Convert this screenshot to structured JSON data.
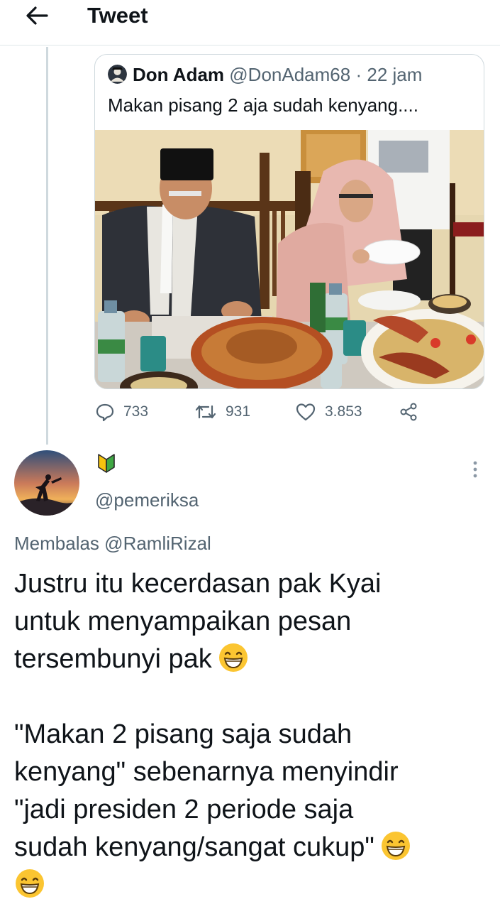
{
  "header": {
    "title": "Tweet"
  },
  "quoted_tweet": {
    "name": "Don Adam",
    "handle": "@DonAdam68",
    "separator": "·",
    "time": "22 jam",
    "text": "Makan pisang 2 aja sudah kenyang...."
  },
  "actions": {
    "replies": "733",
    "retweets": "931",
    "likes": "3.853"
  },
  "reply": {
    "handle": "@pemeriksa",
    "replying_prefix": "Membalas",
    "replying_to": "@RamliRizal",
    "paragraph1": {
      "line1": "Justru itu kecerdasan pak Kyai",
      "line2": "untuk menyampaikan pesan",
      "line3": "tersembunyi pak"
    },
    "paragraph2": {
      "line1": "\"Makan 2 pisang saja sudah",
      "line2": "kenyang\" sebenarnya menyindir",
      "line3": "\"jadi presiden 2 periode saja",
      "line4": "sudah kenyang/sangat cukup\""
    }
  },
  "icons": {
    "back": "arrow-left-icon",
    "reply": "comment-icon",
    "retweet": "retweet-icon",
    "like": "heart-icon",
    "share": "share-icon",
    "emoji": "grinning-face-emoji",
    "badge": "beginner-symbol-icon",
    "more": "vertical-dots-icon"
  },
  "colors": {
    "text": "#0f1419",
    "secondary": "#536471",
    "border": "#cfd9de",
    "emoji": "#fbc531"
  }
}
